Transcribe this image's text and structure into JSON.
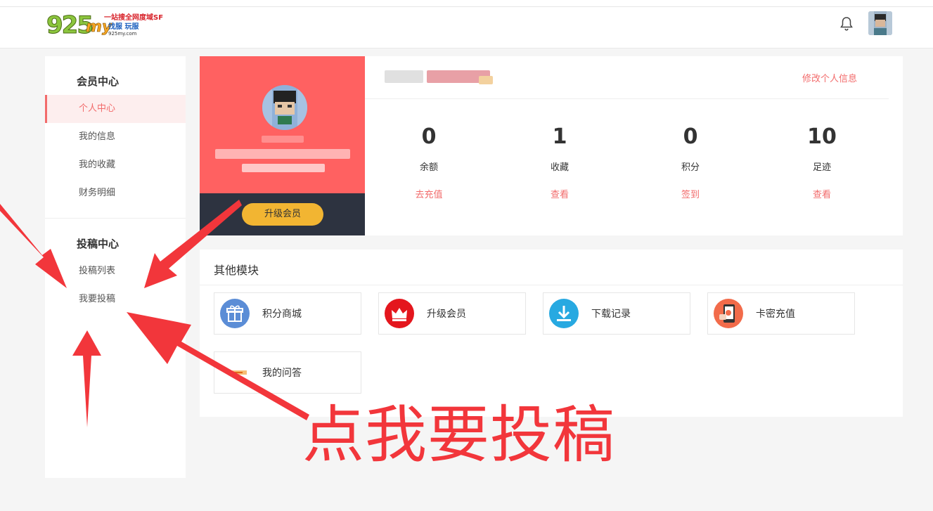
{
  "header": {
    "logo": {
      "number": "925",
      "suffix": "my",
      "line1": "一站搜全网度域SF",
      "line2": "找服 玩服",
      "line3": "925my.com"
    },
    "bell_icon": "bell-icon",
    "avatar_icon": "user-avatar"
  },
  "sidebar": {
    "member_title": "会员中心",
    "member_items": [
      {
        "label": "个人中心",
        "active": true
      },
      {
        "label": "我的信息",
        "active": false
      },
      {
        "label": "我的收藏",
        "active": false
      },
      {
        "label": "财务明细",
        "active": false
      }
    ],
    "submit_title": "投稿中心",
    "submit_items": [
      {
        "label": "投稿列表"
      },
      {
        "label": "我要投稿"
      }
    ]
  },
  "profile": {
    "upgrade_label": "升级会员",
    "edit_label": "修改个人信息",
    "stats": [
      {
        "value": "0",
        "label": "余额",
        "action": "去充值"
      },
      {
        "value": "1",
        "label": "收藏",
        "action": "查看"
      },
      {
        "value": "0",
        "label": "积分",
        "action": "签到"
      },
      {
        "value": "10",
        "label": "足迹",
        "action": "查看"
      }
    ]
  },
  "modules": {
    "title": "其他模块",
    "items": [
      {
        "label": "积分商城",
        "icon": "gift-icon",
        "color": "#5b8dd6"
      },
      {
        "label": "升级会员",
        "icon": "crown-icon",
        "color": "#e4161d"
      },
      {
        "label": "下载记录",
        "icon": "download-icon",
        "color": "#27a9e1"
      },
      {
        "label": "卡密充值",
        "icon": "phone-card-icon",
        "color": "#f26b4a"
      },
      {
        "label": "我的问答",
        "icon": "qa-icon",
        "color": "#f2a33a"
      }
    ]
  },
  "annotation": {
    "text": "点我要投稿",
    "color": "#f2363b"
  },
  "colors": {
    "accent": "#f26b6b",
    "profile_bg": "#ff6161",
    "dark_bar": "#2d3340",
    "upgrade_btn": "#f2b532"
  }
}
